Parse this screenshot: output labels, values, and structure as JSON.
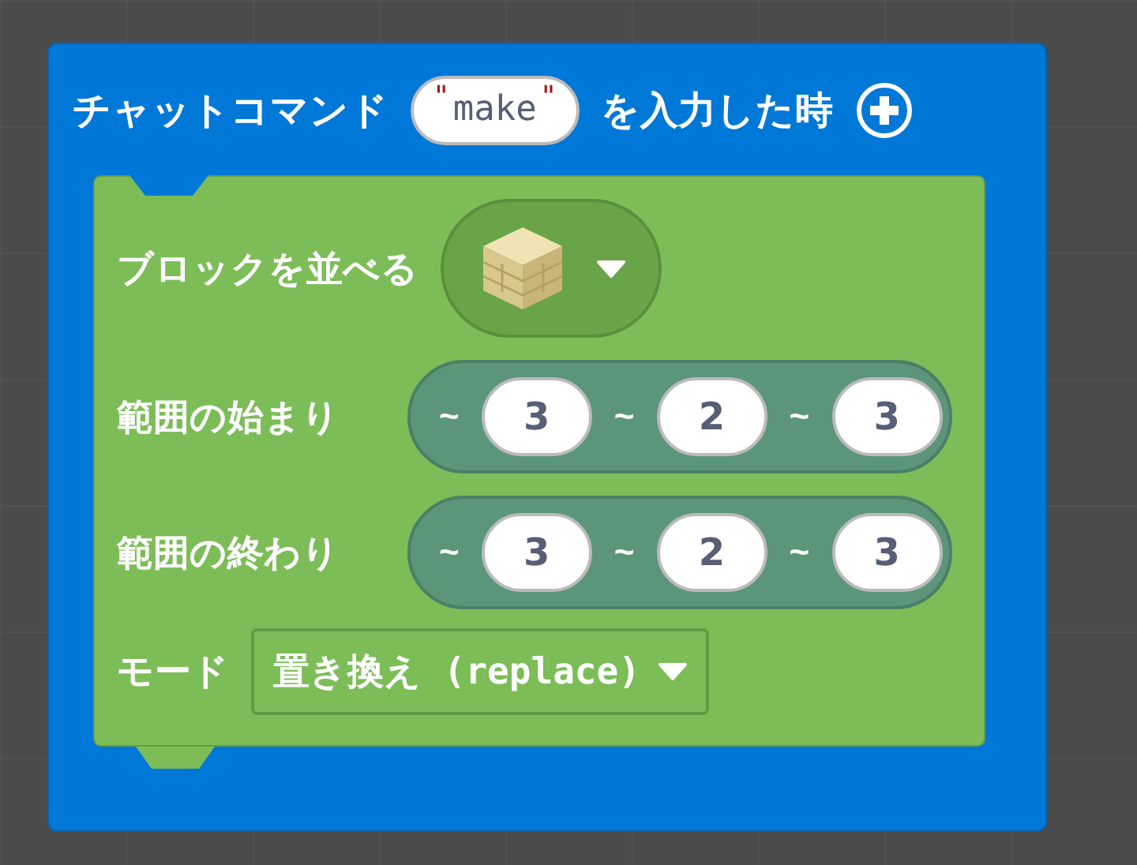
{
  "event_block": {
    "label_before": "チャットコマンド",
    "command": {
      "open_quote": "\"",
      "value": "make",
      "close_quote": "\""
    },
    "label_after": "を入力した時",
    "body": {
      "label": "ブロックを並べる",
      "positions": [
        {
          "label": "範囲の始まり",
          "coords": [
            {
              "prefix": "~",
              "value": "3"
            },
            {
              "prefix": "~",
              "value": "2"
            },
            {
              "prefix": "~",
              "value": "3"
            }
          ]
        },
        {
          "label": "範囲の終わり",
          "coords": [
            {
              "prefix": "~",
              "value": "3"
            },
            {
              "prefix": "~",
              "value": "2"
            },
            {
              "prefix": "~",
              "value": "3"
            }
          ]
        }
      ],
      "mode": {
        "label": "モード",
        "value": "置き換え (replace)"
      }
    }
  }
}
